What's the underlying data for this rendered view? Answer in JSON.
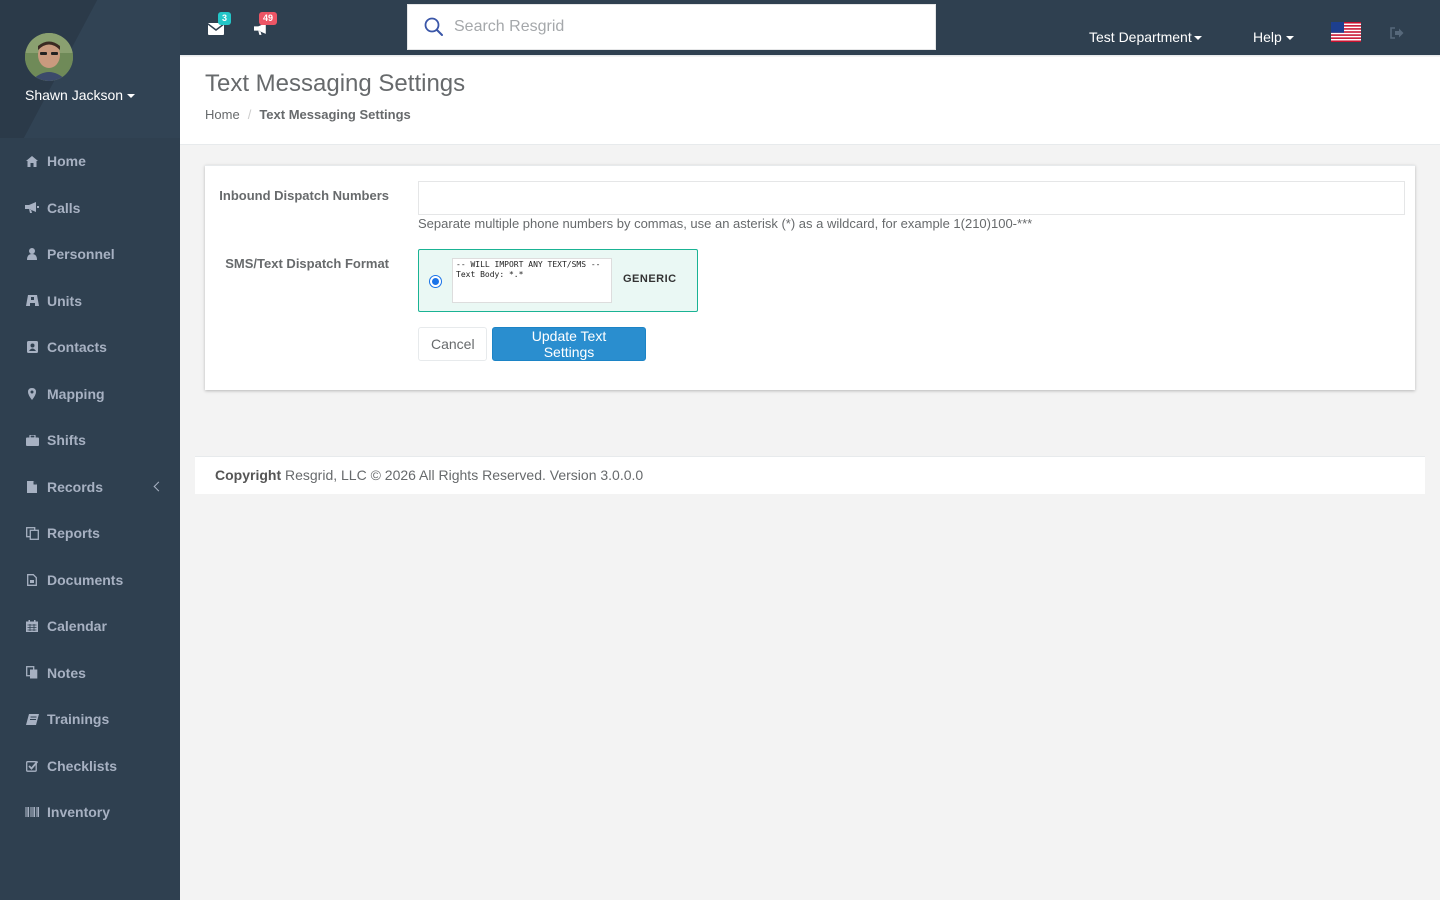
{
  "user": {
    "name": "Shawn Jackson"
  },
  "sidebar": {
    "items": [
      {
        "label": "Home",
        "icon": "home-icon"
      },
      {
        "label": "Calls",
        "icon": "bullhorn-icon"
      },
      {
        "label": "Personnel",
        "icon": "user-icon"
      },
      {
        "label": "Units",
        "icon": "truck-icon"
      },
      {
        "label": "Contacts",
        "icon": "address-book-icon"
      },
      {
        "label": "Mapping",
        "icon": "map-marker-icon"
      },
      {
        "label": "Shifts",
        "icon": "briefcase-icon"
      },
      {
        "label": "Records",
        "icon": "file-icon"
      },
      {
        "label": "Reports",
        "icon": "copy-icon"
      },
      {
        "label": "Documents",
        "icon": "document-icon"
      },
      {
        "label": "Calendar",
        "icon": "calendar-icon"
      },
      {
        "label": "Notes",
        "icon": "files-icon"
      },
      {
        "label": "Trainings",
        "icon": "book-icon"
      },
      {
        "label": "Checklists",
        "icon": "check-square-icon"
      },
      {
        "label": "Inventory",
        "icon": "barcode-icon"
      }
    ]
  },
  "topbar": {
    "messages_count": "3",
    "calls_count": "49",
    "search_placeholder": "Search Resgrid",
    "department": "Test Department",
    "help": "Help"
  },
  "page": {
    "title": "Text Messaging Settings",
    "breadcrumb_home": "Home",
    "breadcrumb_current": "Text Messaging Settings"
  },
  "form": {
    "inbound_label": "Inbound Dispatch Numbers",
    "inbound_value": "",
    "inbound_help": "Separate multiple phone numbers by commas, use an asterisk (*) as a wildcard, for example 1(210)100-***",
    "format_label": "SMS/Text Dispatch Format",
    "format_sample": "-- WILL IMPORT ANY TEXT/SMS --\nText Body: *.*",
    "format_name": "GENERIC",
    "cancel": "Cancel",
    "update": "Update Text Settings"
  },
  "footer": {
    "copyright_bold": "Copyright",
    "copyright_text": " Resgrid, LLC © 2026 All Rights Reserved.",
    "version": " Version 3.0.0.0"
  },
  "colors": {
    "sidebar": "#2f4050",
    "nav_text": "#a7b1c2",
    "primary": "#2a8ecf",
    "accent_green": "#1ab394",
    "badge_info": "#23c6c8",
    "badge_danger": "#ed5565"
  }
}
